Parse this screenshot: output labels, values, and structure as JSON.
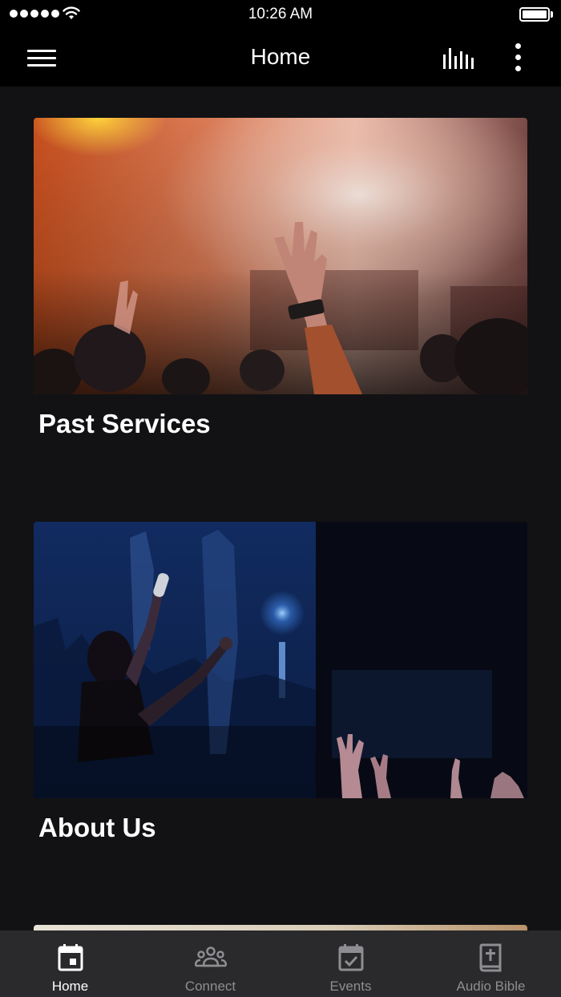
{
  "status_bar": {
    "time": "10:26 AM"
  },
  "nav": {
    "title": "Home",
    "left_icon": "hamburger-menu-icon",
    "right_icons": [
      "audio-bars-icon",
      "more-vertical-icon"
    ]
  },
  "cards": [
    {
      "title": "Past Services",
      "image": "concert-crowd-orange-stage-photo"
    },
    {
      "title": "About Us",
      "image": "worship-concert-blue-stage-photo"
    },
    {
      "title": "",
      "image": "partial-beige-photo"
    }
  ],
  "tabs": [
    {
      "label": "Home",
      "icon": "calendar-day-icon",
      "active": true
    },
    {
      "label": "Connect",
      "icon": "group-people-icon",
      "active": false
    },
    {
      "label": "Events",
      "icon": "calendar-check-icon",
      "active": false
    },
    {
      "label": "Audio Bible",
      "icon": "bible-book-icon",
      "active": false
    }
  ],
  "colors": {
    "background": "#121214",
    "bars": "#000000",
    "tab_bar": "#2a2a2c",
    "active_tab": "#ffffff",
    "inactive_tab": "#8e8e92"
  }
}
